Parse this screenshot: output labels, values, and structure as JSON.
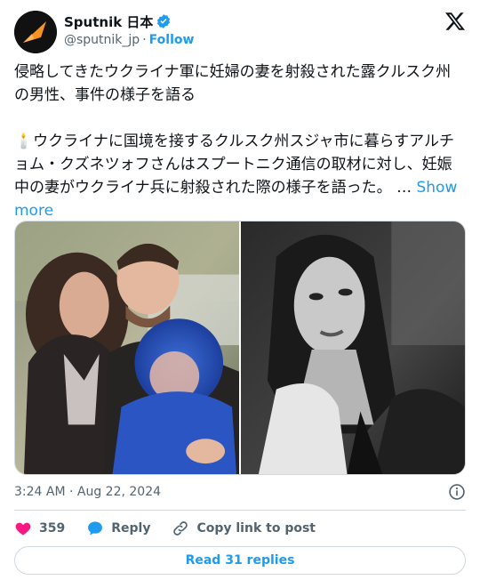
{
  "account": {
    "name": "Sputnik 日本",
    "handle": "@sputnik_jp",
    "separator": "·",
    "follow_label": "Follow"
  },
  "tweet": {
    "headline": "侵略してきたウクライナ軍に妊婦の妻を射殺された露クルスク州の男性、事件の様子を語る",
    "candle_icon": "🕯️",
    "body": "ウクライナに国境を接するクルスク州スジャ市に暮らすアルチョム・クズネツォフさんはスプートニク通信の取材に対し、妊娠中の妻がウクライナ兵に射殺された際の様子を語った。",
    "ellipsis": " … ",
    "show_more": "Show more"
  },
  "meta": {
    "timestamp": "3:24 AM · Aug 22, 2024"
  },
  "actions": {
    "like_count": "359",
    "reply_label": "Reply",
    "copy_label": "Copy link to post"
  },
  "replies_button": "Read 31 replies",
  "colors": {
    "accent": "#1d9bf0",
    "like": "#f91880",
    "muted": "#536471"
  }
}
